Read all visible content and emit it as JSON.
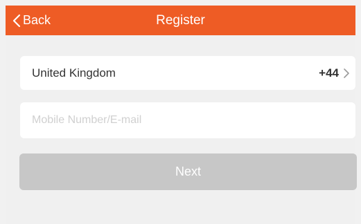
{
  "header": {
    "back_label": "Back",
    "title": "Register",
    "background_color": "#ee5c25"
  },
  "country_selector": {
    "country": "United Kingdom",
    "dial_code": "+44",
    "icon": "chevron-right-icon"
  },
  "contact_input": {
    "value": "",
    "placeholder": "Mobile Number/E-mail"
  },
  "next_button": {
    "label": "Next",
    "enabled": false
  },
  "colors": {
    "accent": "#ee5c25",
    "disabled_button": "#c7c7c7",
    "background": "#f0f0f0"
  }
}
